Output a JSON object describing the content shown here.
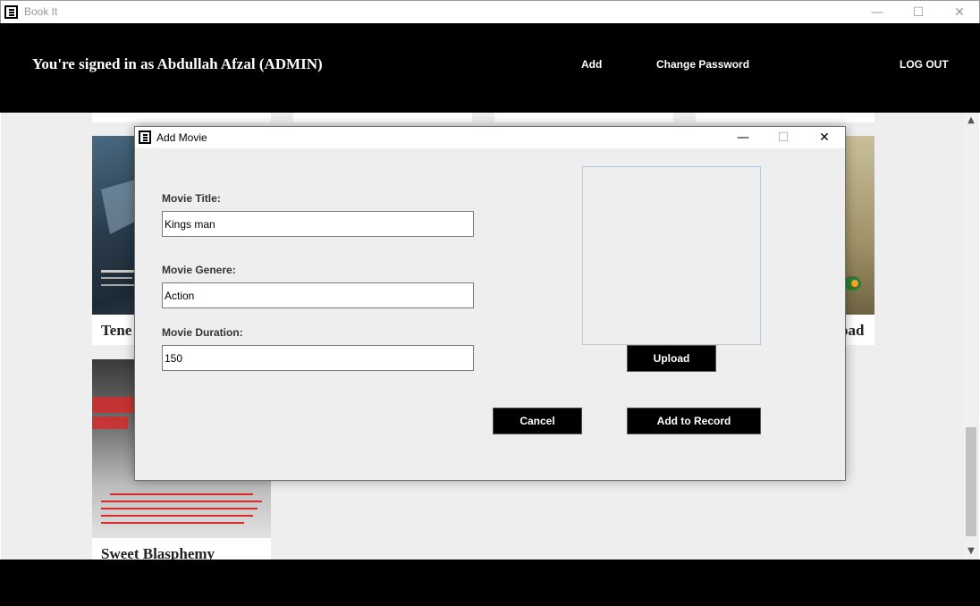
{
  "window": {
    "title": "Book It",
    "controls": {
      "minimize": "—",
      "maximize": "☐",
      "close": "✕"
    }
  },
  "header": {
    "signed_in_text": "You're signed in as Abdullah Afzal (ADMIN)",
    "nav": {
      "add": "Add",
      "change_password": "Change Password",
      "logout": "LOG OUT"
    }
  },
  "movies": [
    {
      "title": "Tenet",
      "visible_title": "Tene"
    },
    {
      "title": "Sweet Blasphemy",
      "visible_title": "Sweet Blasphemy"
    },
    {
      "visible_title": "oad"
    }
  ],
  "dialog": {
    "title": "Add Movie",
    "controls": {
      "minimize": "—",
      "maximize": "☐",
      "close": "✕"
    },
    "fields": {
      "title_label": "Movie Title:",
      "title_value": "Kings man",
      "genre_label": "Movie Genere:",
      "genre_value": "Action",
      "duration_label": "Movie Duration:",
      "duration_value": "150"
    },
    "buttons": {
      "upload": "Upload",
      "cancel": "Cancel",
      "add": "Add to Record"
    }
  },
  "colors": {
    "header_bg": "#000000",
    "content_bg": "#eeeeee",
    "button_bg": "#000000",
    "button_text": "#ffffff"
  }
}
